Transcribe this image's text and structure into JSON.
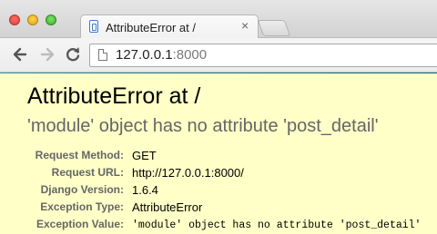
{
  "browser": {
    "tab": {
      "title": "AttributeError at /",
      "close_glyph": "×",
      "icon": "page-icon"
    },
    "address_bar": {
      "host": "127.0.0.1",
      "port": ":8000"
    },
    "nav_icons": [
      "back-arrow-icon",
      "forward-arrow-icon",
      "reload-icon"
    ]
  },
  "error_page": {
    "title": "AttributeError at /",
    "subtitle": "'module' object has no attribute 'post_detail'",
    "meta": [
      {
        "label": "Request Method:",
        "value": "GET"
      },
      {
        "label": "Request URL:",
        "value": "http://127.0.0.1:8000/"
      },
      {
        "label": "Django Version:",
        "value": "1.6.4"
      },
      {
        "label": "Exception Type:",
        "value": "AttributeError"
      },
      {
        "label": "Exception Value:",
        "value": "'module' object has no attribute 'post_detail'"
      }
    ],
    "background_color": "#ffffc8"
  }
}
